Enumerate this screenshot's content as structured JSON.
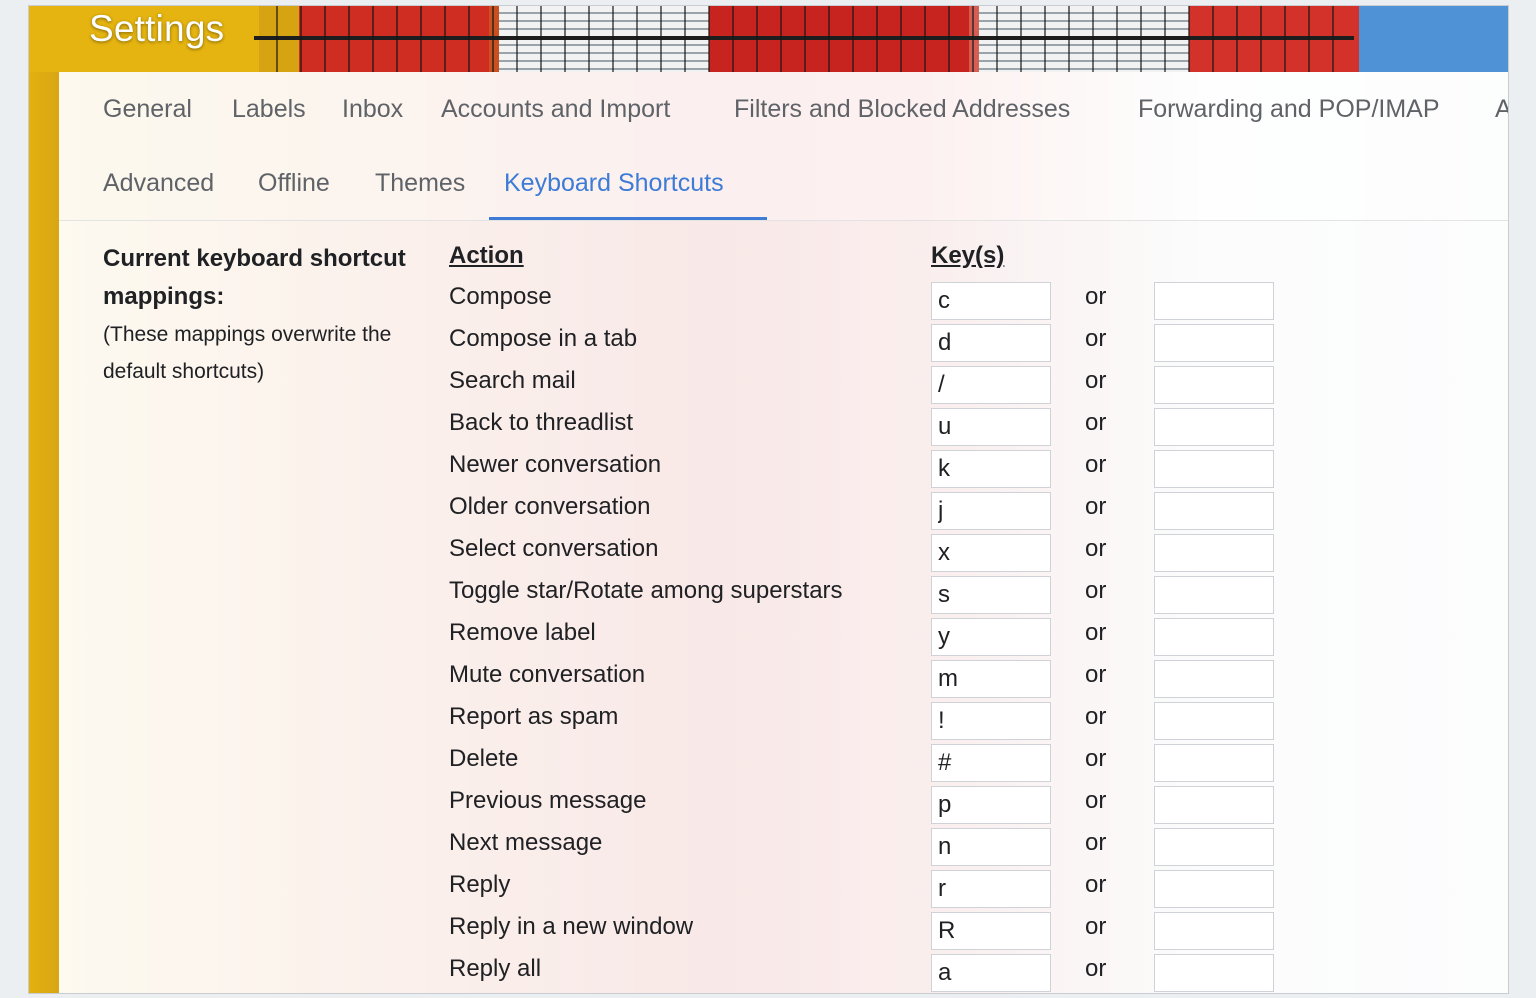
{
  "header": {
    "title": "Settings"
  },
  "tabs_row1": [
    "General",
    "Labels",
    "Inbox",
    "Accounts and Import",
    "Filters and Blocked Addresses",
    "Forwarding and POP/IMAP",
    "A"
  ],
  "tabs_row2": [
    "Advanced",
    "Offline",
    "Themes",
    "Keyboard Shortcuts"
  ],
  "active_tab": "Keyboard Shortcuts",
  "description": {
    "title": "Current keyboard shortcut mappings:",
    "note": "(These mappings overwrite the default shortcuts)"
  },
  "columns": {
    "action": "Action",
    "keys": "Key(s)"
  },
  "or_label": "or",
  "shortcuts": [
    {
      "action": "Compose",
      "key": "c",
      "alt": ""
    },
    {
      "action": "Compose in a tab",
      "key": "d",
      "alt": ""
    },
    {
      "action": "Search mail",
      "key": "/",
      "alt": ""
    },
    {
      "action": "Back to threadlist",
      "key": "u",
      "alt": ""
    },
    {
      "action": "Newer conversation",
      "key": "k",
      "alt": ""
    },
    {
      "action": "Older conversation",
      "key": "j",
      "alt": ""
    },
    {
      "action": "Select conversation",
      "key": "x",
      "alt": ""
    },
    {
      "action": "Toggle star/Rotate among superstars",
      "key": "s",
      "alt": ""
    },
    {
      "action": "Remove label",
      "key": "y",
      "alt": ""
    },
    {
      "action": "Mute conversation",
      "key": "m",
      "alt": ""
    },
    {
      "action": "Report as spam",
      "key": "!",
      "alt": ""
    },
    {
      "action": "Delete",
      "key": "#",
      "alt": ""
    },
    {
      "action": "Previous message",
      "key": "p",
      "alt": ""
    },
    {
      "action": "Next message",
      "key": "n",
      "alt": ""
    },
    {
      "action": "Reply",
      "key": "r",
      "alt": ""
    },
    {
      "action": "Reply in a new window",
      "key": "R",
      "alt": ""
    },
    {
      "action": "Reply all",
      "key": "a",
      "alt": ""
    }
  ],
  "colors": {
    "accent": "#3d7bd6",
    "tab_text": "#5f6368",
    "text": "#202124"
  }
}
